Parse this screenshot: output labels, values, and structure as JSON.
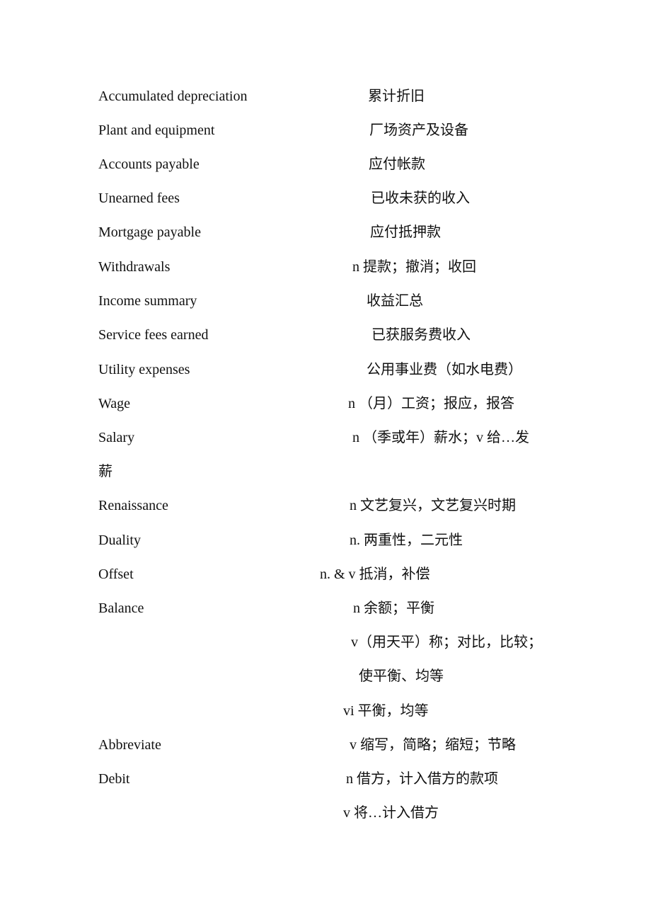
{
  "glossary": [
    {
      "term": "Accumulated depreciation",
      "definition": "累计折旧"
    },
    {
      "term": "Plant and equipment",
      "definition": "厂场资产及设备"
    },
    {
      "term": "Accounts payable",
      "definition": "应付帐款"
    },
    {
      "term": "Unearned fees",
      "definition": "已收未获的收入"
    },
    {
      "term": "Mortgage payable",
      "definition": "应付抵押款"
    },
    {
      "term": "Withdrawals",
      "definition": "n  提款；撤消；收回"
    },
    {
      "term": "Income summary",
      "definition": "收益汇总"
    },
    {
      "term": "Service fees earned",
      "definition": "已获服务费收入"
    },
    {
      "term": "Utility expenses",
      "definition": "公用事业费（如水电费）"
    },
    {
      "term": "Wage",
      "definition": "n  （月）工资；报应，报答"
    },
    {
      "term": "Salary",
      "definition": "n  （季或年）薪水；v  给…发"
    },
    {
      "term": "薪",
      "definition": ""
    },
    {
      "term": "Renaissance",
      "definition": "n  文艺复兴，文艺复兴时期"
    },
    {
      "term": "Duality",
      "definition": "n.  两重性，二元性"
    },
    {
      "term": "Offset",
      "definition": "n. & v 抵消，补偿"
    },
    {
      "term": "Balance",
      "definition": "n 余额；平衡"
    },
    {
      "term": "",
      "definition": "v（用天平）称；对比，比较；"
    },
    {
      "term": "",
      "definition": "使平衡、均等"
    },
    {
      "term": "",
      "definition": "vi  平衡，均等"
    },
    {
      "term": "Abbreviate",
      "definition": "v  缩写，简略；缩短；节略"
    },
    {
      "term": "Debit",
      "definition": "n  借方，计入借方的款项"
    },
    {
      "term": "",
      "definition": "v 将…计入借方"
    }
  ]
}
